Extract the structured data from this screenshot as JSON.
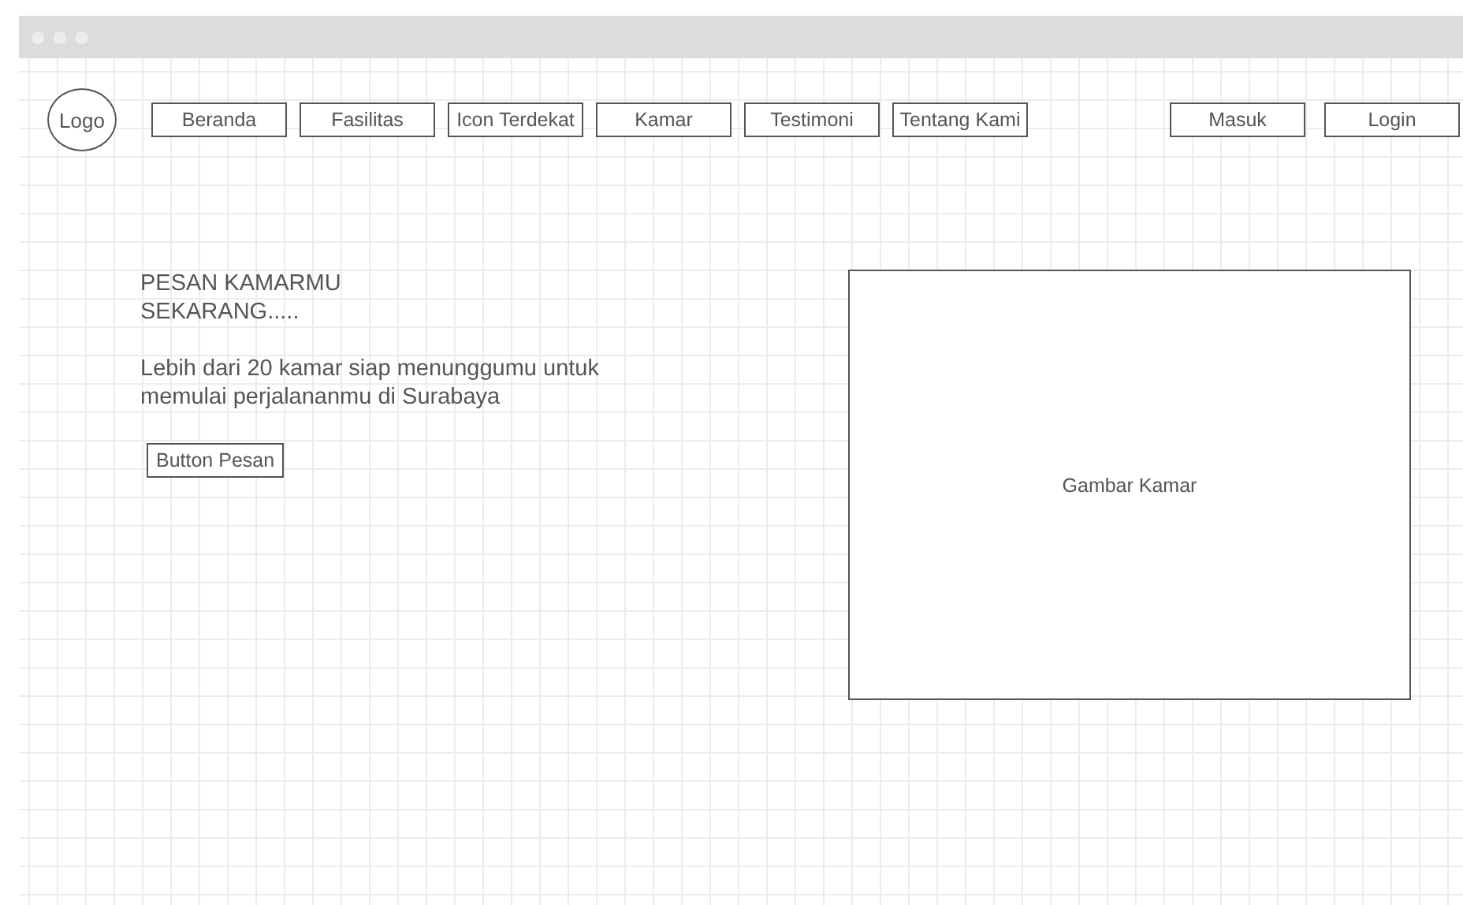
{
  "logo": "Logo",
  "nav_items": [
    {
      "label": "Beranda"
    },
    {
      "label": "Fasilitas"
    },
    {
      "label": "Icon Terdekat"
    },
    {
      "label": "Kamar"
    },
    {
      "label": "Testimoni"
    },
    {
      "label": "Tentang Kami"
    }
  ],
  "auth_buttons": [
    {
      "label": "Masuk"
    },
    {
      "label": "Login"
    }
  ],
  "hero": {
    "heading": "PESAN KAMARMU SEKARANG.....",
    "text": "Lebih dari 20 kamar siap menunggumu untuk memulai perjalananmu di Surabaya",
    "button": "Button Pesan"
  },
  "image_placeholder": "Gambar Kamar"
}
